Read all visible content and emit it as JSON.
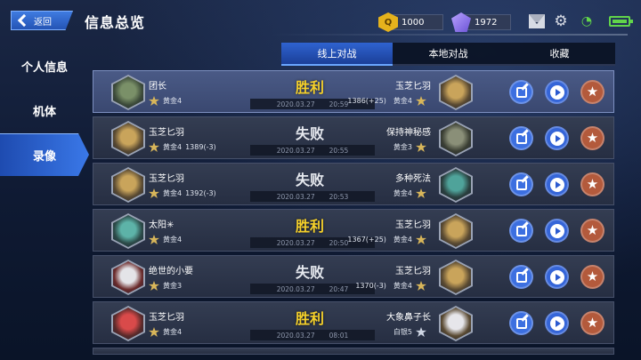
{
  "header": {
    "back_label": "返回",
    "title": "信息总览",
    "gold": "1000",
    "gems": "1972",
    "gold_icon_char": "Q"
  },
  "sidebar": {
    "items": [
      {
        "label": "个人信息"
      },
      {
        "label": "机体"
      },
      {
        "label": "录像"
      }
    ],
    "active_index": 2
  },
  "tabs": [
    {
      "label": "线上对战",
      "active": true
    },
    {
      "label": "本地对战",
      "active": false
    },
    {
      "label": "收藏",
      "active": false
    }
  ],
  "matches": [
    {
      "left_name": "团长",
      "left_rank": "黄金4",
      "left_score": "",
      "result": "胜利",
      "win": true,
      "date": "2020.03.27",
      "time": "20:59",
      "right_name": "玉芝匕羽",
      "right_rank": "黄金4",
      "right_score": "1386(+25)",
      "selected": true,
      "left_colors": [
        "#7a9068",
        "#3d4b3a"
      ],
      "right_colors": [
        "#c9a45b",
        "#5a4a32"
      ]
    },
    {
      "left_name": "玉芝匕羽",
      "left_rank": "黄金4",
      "left_score": "1389(-3)",
      "result": "失败",
      "win": false,
      "date": "2020.03.27",
      "time": "20:55",
      "right_name": "保持神秘感",
      "right_rank": "黄金3",
      "right_score": "",
      "selected": false,
      "left_colors": [
        "#c9a45b",
        "#5a4a32"
      ],
      "right_colors": [
        "#8a8f78",
        "#3a3e33"
      ]
    },
    {
      "left_name": "玉芝匕羽",
      "left_rank": "黄金4",
      "left_score": "1392(-3)",
      "result": "失败",
      "win": false,
      "date": "2020.03.27",
      "time": "20:53",
      "right_name": "多种死法",
      "right_rank": "黄金4",
      "right_score": "",
      "selected": false,
      "left_colors": [
        "#c9a45b",
        "#5a4a32"
      ],
      "right_colors": [
        "#4fa39a",
        "#2a3f3e"
      ]
    },
    {
      "left_name": "太阳✳",
      "left_rank": "黄金4",
      "left_score": "",
      "result": "胜利",
      "win": true,
      "date": "2020.03.27",
      "time": "20:50",
      "right_name": "玉芝匕羽",
      "right_rank": "黄金4",
      "right_score": "1367(+25)",
      "selected": false,
      "left_colors": [
        "#5db3a8",
        "#2c4a48"
      ],
      "right_colors": [
        "#c9a45b",
        "#5a4a32"
      ]
    },
    {
      "left_name": "绝世的小要",
      "left_rank": "黄金3",
      "left_score": "",
      "result": "失败",
      "win": false,
      "date": "2020.03.27",
      "time": "20:47",
      "right_name": "玉芝匕羽",
      "right_rank": "黄金4",
      "right_score": "1370(-3)",
      "selected": false,
      "left_colors": [
        "#e4e4e8",
        "#6b2b2b"
      ],
      "right_colors": [
        "#c9a45b",
        "#5a4a32"
      ]
    },
    {
      "left_name": "玉芝匕羽",
      "left_rank": "黄金4",
      "left_score": "",
      "result": "胜利",
      "win": true,
      "date": "2020.03.27",
      "time": "08:01",
      "right_name": "大象鼻子长",
      "right_rank": "白银5",
      "right_score": "",
      "selected": false,
      "left_colors": [
        "#d94a4a",
        "#5a2a2a"
      ],
      "right_colors": [
        "#e6e6ea",
        "#5a4a32"
      ]
    }
  ]
}
